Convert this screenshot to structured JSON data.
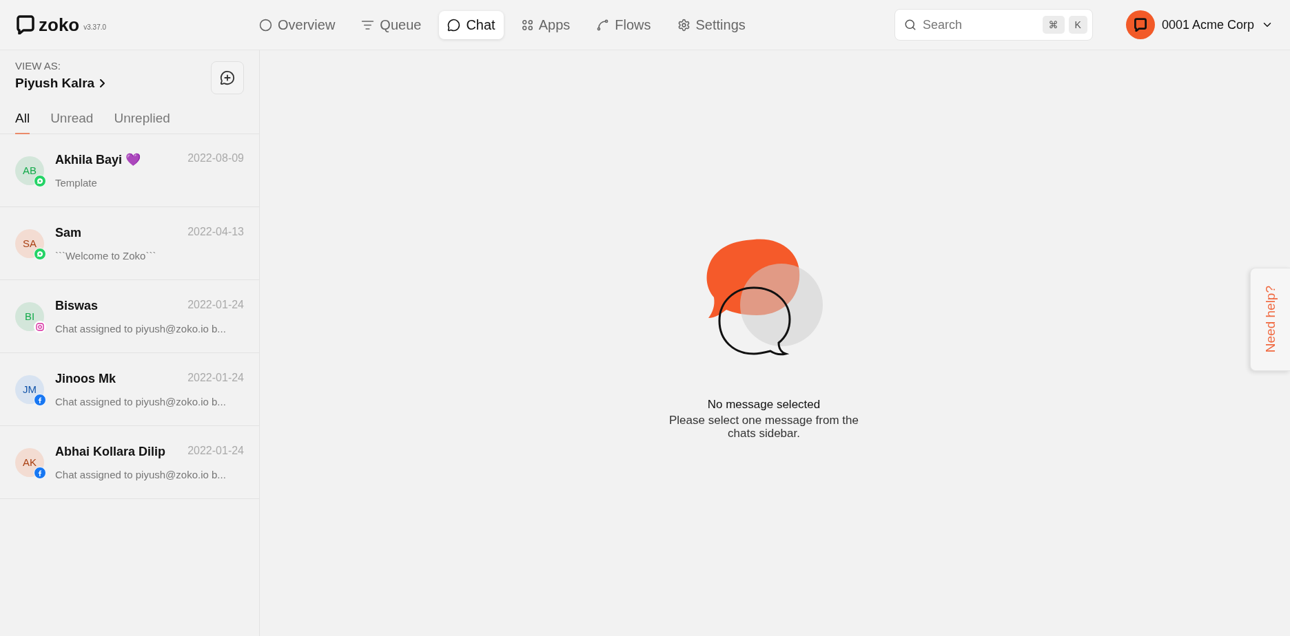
{
  "brand": {
    "name": "zoko",
    "version": "v3.37.0"
  },
  "nav": [
    {
      "label": "Overview",
      "kind": "overview",
      "selected": false
    },
    {
      "label": "Queue",
      "kind": "queue",
      "selected": false
    },
    {
      "label": "Chat",
      "kind": "chat",
      "selected": true
    },
    {
      "label": "Apps",
      "kind": "apps",
      "selected": false
    },
    {
      "label": "Flows",
      "kind": "flows",
      "selected": false
    },
    {
      "label": "Settings",
      "kind": "settings",
      "selected": false
    }
  ],
  "search": {
    "placeholder": "Search",
    "keys": [
      "⌘",
      "K"
    ]
  },
  "account": {
    "name": "0001 Acme Corp"
  },
  "sidebar": {
    "view_as_label": "VIEW AS:",
    "view_as_name": "Piyush Kalra",
    "tabs": [
      {
        "label": "All",
        "selected": true
      },
      {
        "label": "Unread",
        "selected": false
      },
      {
        "label": "Unreplied",
        "selected": false
      }
    ],
    "chats": [
      {
        "initials": "AB",
        "color": "#d3e6da",
        "name": "Akhila Bayi 💜",
        "date": "2022-08-09",
        "preview": "Template",
        "kind": "whatsapp"
      },
      {
        "initials": "SA",
        "color": "#f3dcd2",
        "name": "Sam",
        "date": "2022-04-13",
        "preview": "```Welcome to Zoko```",
        "kind": "whatsapp"
      },
      {
        "initials": "BI",
        "color": "#d3e6da",
        "name": "Biswas",
        "date": "2022-01-24",
        "preview": "Chat assigned to piyush@zoko.io b...",
        "kind": "instagram"
      },
      {
        "initials": "JM",
        "color": "#d8e3f1",
        "name": "Jinoos Mk",
        "date": "2022-01-24",
        "preview": "Chat assigned to piyush@zoko.io b...",
        "kind": "facebook"
      },
      {
        "initials": "AK",
        "color": "#f3dcd2",
        "name": "Abhai Kollara Dilip",
        "date": "2022-01-24",
        "preview": "Chat assigned to piyush@zoko.io b...",
        "kind": "facebook"
      }
    ]
  },
  "empty_state": {
    "title": "No message selected",
    "message": "Please select one message from the chats sidebar."
  },
  "help_tab": {
    "label": "Need help?"
  }
}
